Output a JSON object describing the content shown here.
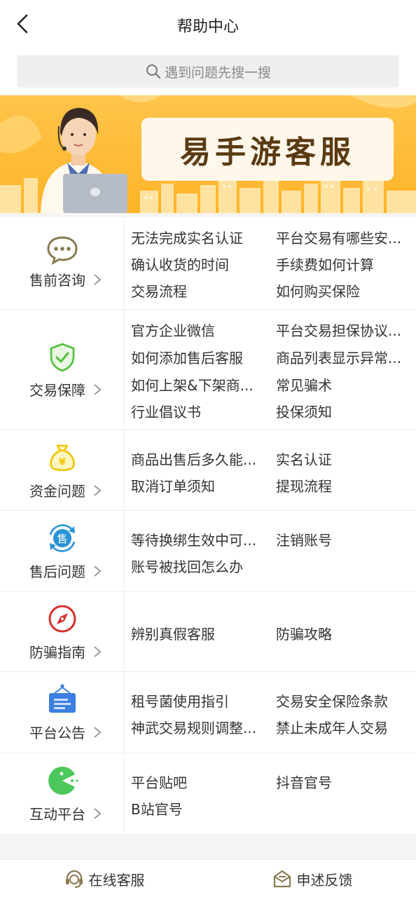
{
  "header": {
    "title": "帮助中心"
  },
  "search": {
    "placeholder": "遇到问题先搜一搜"
  },
  "banner": {
    "title": "易手游客服"
  },
  "categories": [
    {
      "label": "售前咨询",
      "icon": "chat-bubble-icon",
      "questions": [
        "无法完成实名认证",
        "平台交易有哪些安...",
        "确认收货的时间",
        "手续费如何计算",
        "交易流程",
        "如何购买保险"
      ]
    },
    {
      "label": "交易保障",
      "icon": "shield-check-icon",
      "questions": [
        "官方企业微信",
        "平台交易担保协议...",
        "如何添加售后客服",
        "商品列表显示异常...",
        "如何上架&下架商...",
        "常见骗术",
        "行业倡议书",
        "投保须知"
      ]
    },
    {
      "label": "资金问题",
      "icon": "money-bag-icon",
      "questions": [
        "商品出售后多久能...",
        "实名认证",
        "取消订单须知",
        "提现流程"
      ]
    },
    {
      "label": "售后问题",
      "icon": "after-sale-icon",
      "questions": [
        "等待换绑生效中可...",
        "注销账号",
        "账号被找回怎么办"
      ]
    },
    {
      "label": "防骗指南",
      "icon": "compass-icon",
      "questions": [
        "辨别真假客服",
        "防骗攻略"
      ]
    },
    {
      "label": "平台公告",
      "icon": "notice-board-icon",
      "questions": [
        "租号菌使用指引",
        "交易安全保险条款",
        "神武交易规则调整...",
        "禁止未成年人交易"
      ]
    },
    {
      "label": "互动平台",
      "icon": "pacman-icon",
      "questions": [
        "平台贴吧",
        "抖音官号",
        "B站官号"
      ]
    }
  ],
  "bottom": {
    "online_service": "在线客服",
    "feedback": "申述反馈"
  },
  "colors": {
    "banner": "#ffb429",
    "chat": "#8a7a52",
    "shield": "#4fc13a",
    "money": "#f5c400",
    "after_sale": "#2a93d8",
    "compass": "#d8302a",
    "notice": "#3b7fe0",
    "pacman": "#4cc85a"
  }
}
